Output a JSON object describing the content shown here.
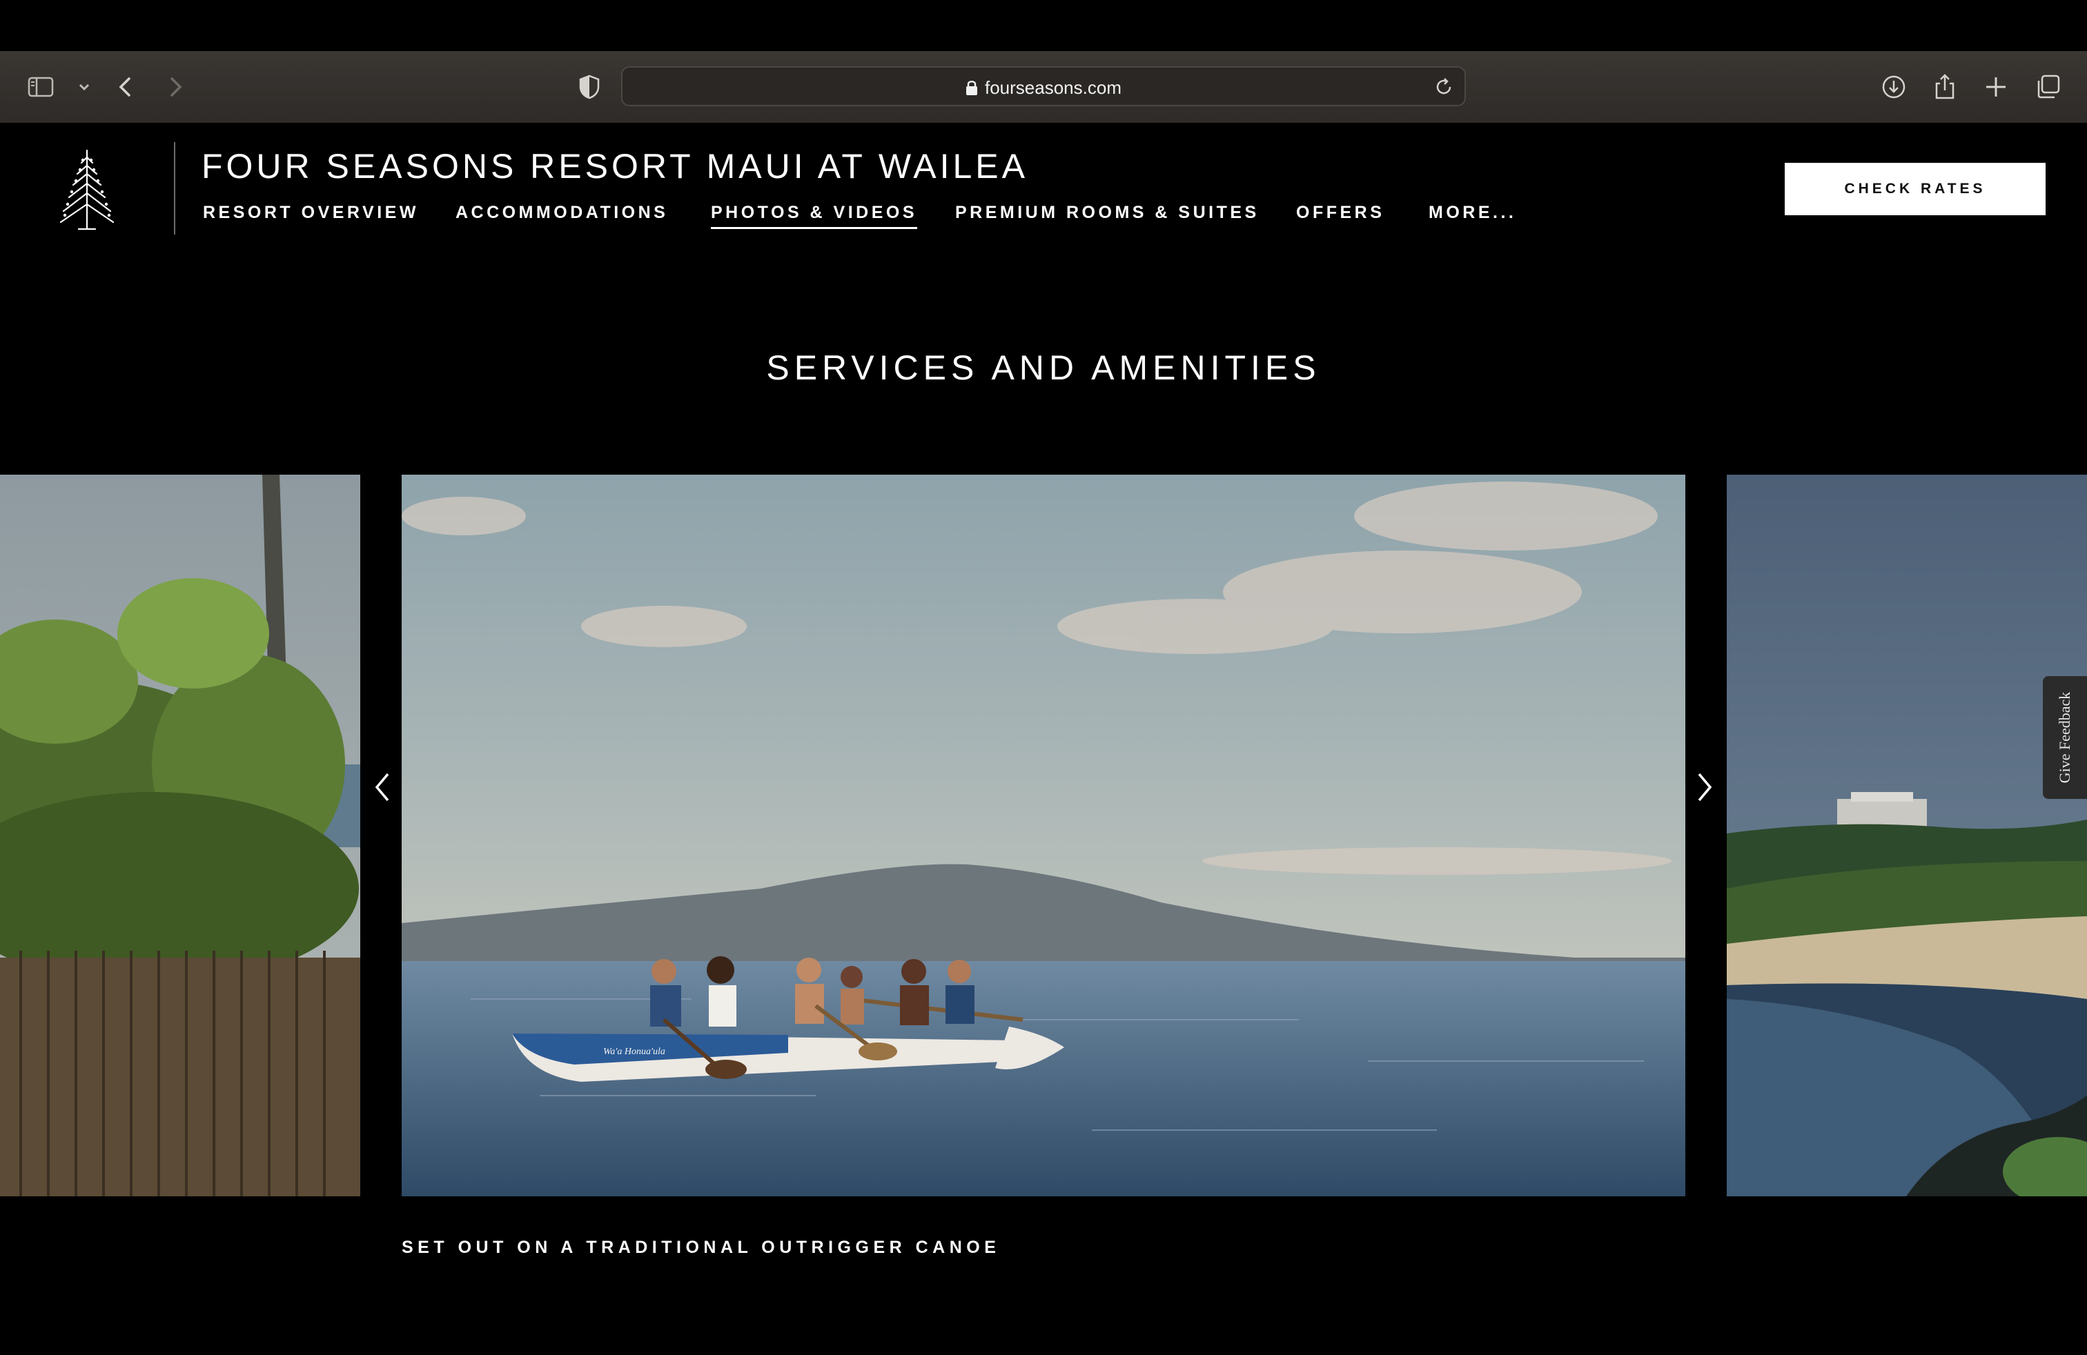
{
  "browser": {
    "url": "fourseasons.com"
  },
  "header": {
    "title": "FOUR SEASONS RESORT MAUI AT WAILEA",
    "nav": [
      {
        "label": "RESORT OVERVIEW"
      },
      {
        "label": "ACCOMMODATIONS"
      },
      {
        "label": "PHOTOS & VIDEOS",
        "active": true
      },
      {
        "label": "PREMIUM ROOMS & SUITES"
      },
      {
        "label": "OFFERS"
      },
      {
        "label": "MORE..."
      }
    ],
    "cta": "CHECK RATES"
  },
  "section": {
    "title": "SERVICES AND AMENITIES"
  },
  "carousel": {
    "caption": "SET OUT ON A TRADITIONAL OUTRIGGER CANOE",
    "canoe_name": "Wa'a Honua'ula"
  },
  "feedback": {
    "label": "Give Feedback"
  },
  "colors": {
    "background": "#000000",
    "browser_bar": "#35322f",
    "cta_bg": "#ffffff",
    "cta_text": "#111111"
  }
}
